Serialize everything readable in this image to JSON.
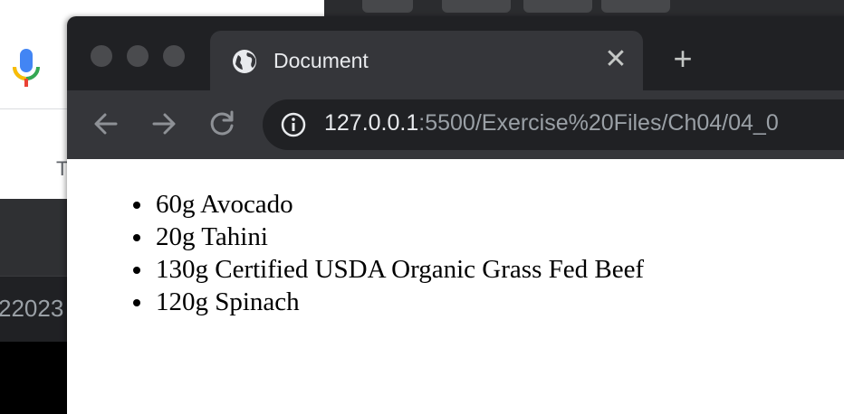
{
  "background": {
    "partial_text_left": "T",
    "partial_text_dark": "22023"
  },
  "browser": {
    "tab": {
      "title": "Document",
      "close_glyph": "✕",
      "globe_icon": "globe-icon"
    },
    "new_tab_glyph": "+",
    "toolbar": {
      "back_icon": "arrow-left-icon",
      "forward_icon": "arrow-right-icon",
      "reload_icon": "reload-icon",
      "info_icon": "info-icon",
      "url_host": "127.0.0.1",
      "url_rest": ":5500/Exercise%20Files/Ch04/04_0"
    },
    "colors": {
      "titlebar": "#202124",
      "tab_active": "#35363a",
      "omnibox": "#202124",
      "url_host": "#e8eaed",
      "url_rest": "#9aa0a6"
    }
  },
  "page": {
    "list_items": [
      "60g Avocado",
      "20g Tahini",
      "130g Certified USDA Organic Grass Fed Beef",
      "120g Spinach"
    ]
  }
}
